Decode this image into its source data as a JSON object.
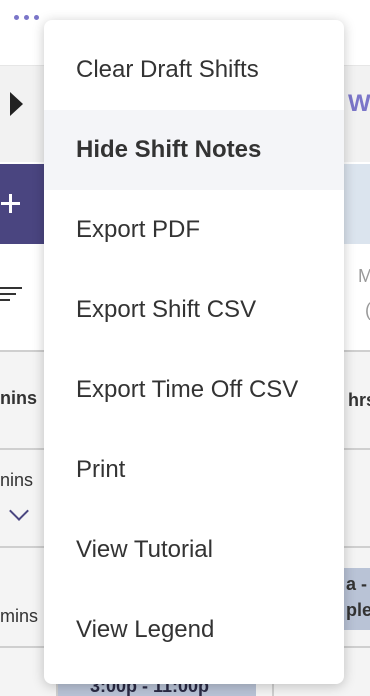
{
  "background": {
    "week_label": "W",
    "day_header_a": "M",
    "day_header_b": "(",
    "rows": [
      {
        "left": "nins",
        "right": "hrs"
      },
      {
        "left": "nins"
      },
      {
        "left": "mins",
        "right_a": "a -",
        "right_b": "ple"
      }
    ],
    "bottom_shift": "3:00p - 11:00p"
  },
  "menu": {
    "items": [
      {
        "label": "Clear Draft Shifts"
      },
      {
        "label": "Hide Shift Notes"
      },
      {
        "label": "Export PDF"
      },
      {
        "label": "Export Shift CSV"
      },
      {
        "label": "Export Time Off CSV"
      },
      {
        "label": "Print"
      },
      {
        "label": "View Tutorial"
      },
      {
        "label": "View Legend"
      }
    ]
  }
}
